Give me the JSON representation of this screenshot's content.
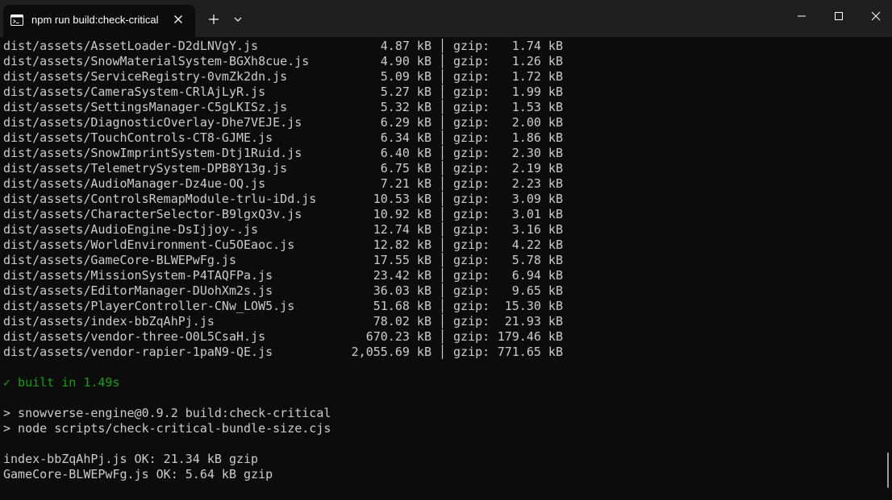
{
  "window": {
    "tab_title": "npm run build:check-critical",
    "tab_icon": "terminal-icon",
    "new_tab_icon": "plus-icon",
    "dropdown_icon": "chevron-down-icon",
    "controls": [
      "minimize-icon",
      "maximize-icon",
      "close-icon"
    ]
  },
  "colors": {
    "background": "#0c0c0c",
    "titlebar": "#1f1f1f",
    "text": "#cccccc",
    "success": "#13a10e"
  },
  "build_output": {
    "rows": [
      {
        "file": "dist/assets/AssetLoader-D2dLNVgY.js",
        "size": "4.87 kB",
        "sep": "│",
        "gzip_label": "gzip:",
        "gzip": "1.74 kB"
      },
      {
        "file": "dist/assets/SnowMaterialSystem-BGXh8cue.js",
        "size": "4.90 kB",
        "sep": "│",
        "gzip_label": "gzip:",
        "gzip": "1.26 kB"
      },
      {
        "file": "dist/assets/ServiceRegistry-0vmZk2dn.js",
        "size": "5.09 kB",
        "sep": "│",
        "gzip_label": "gzip:",
        "gzip": "1.72 kB"
      },
      {
        "file": "dist/assets/CameraSystem-CRlAjLyR.js",
        "size": "5.27 kB",
        "sep": "│",
        "gzip_label": "gzip:",
        "gzip": "1.99 kB"
      },
      {
        "file": "dist/assets/SettingsManager-C5gLKISz.js",
        "size": "5.32 kB",
        "sep": "│",
        "gzip_label": "gzip:",
        "gzip": "1.53 kB"
      },
      {
        "file": "dist/assets/DiagnosticOverlay-Dhe7VEJE.js",
        "size": "6.29 kB",
        "sep": "│",
        "gzip_label": "gzip:",
        "gzip": "2.00 kB"
      },
      {
        "file": "dist/assets/TouchControls-CT8-GJME.js",
        "size": "6.34 kB",
        "sep": "│",
        "gzip_label": "gzip:",
        "gzip": "1.86 kB"
      },
      {
        "file": "dist/assets/SnowImprintSystem-Dtj1Ruid.js",
        "size": "6.40 kB",
        "sep": "│",
        "gzip_label": "gzip:",
        "gzip": "2.30 kB"
      },
      {
        "file": "dist/assets/TelemetrySystem-DPB8Y13g.js",
        "size": "6.75 kB",
        "sep": "│",
        "gzip_label": "gzip:",
        "gzip": "2.19 kB"
      },
      {
        "file": "dist/assets/AudioManager-Dz4ue-OQ.js",
        "size": "7.21 kB",
        "sep": "│",
        "gzip_label": "gzip:",
        "gzip": "2.23 kB"
      },
      {
        "file": "dist/assets/ControlsRemapModule-trlu-iDd.js",
        "size": "10.53 kB",
        "sep": "│",
        "gzip_label": "gzip:",
        "gzip": "3.09 kB"
      },
      {
        "file": "dist/assets/CharacterSelector-B9lgxQ3v.js",
        "size": "10.92 kB",
        "sep": "│",
        "gzip_label": "gzip:",
        "gzip": "3.01 kB"
      },
      {
        "file": "dist/assets/AudioEngine-DsIjjoy-.js",
        "size": "12.74 kB",
        "sep": "│",
        "gzip_label": "gzip:",
        "gzip": "3.16 kB"
      },
      {
        "file": "dist/assets/WorldEnvironment-Cu5OEaoc.js",
        "size": "12.82 kB",
        "sep": "│",
        "gzip_label": "gzip:",
        "gzip": "4.22 kB"
      },
      {
        "file": "dist/assets/GameCore-BLWEPwFg.js",
        "size": "17.55 kB",
        "sep": "│",
        "gzip_label": "gzip:",
        "gzip": "5.78 kB"
      },
      {
        "file": "dist/assets/MissionSystem-P4TAQFPa.js",
        "size": "23.42 kB",
        "sep": "│",
        "gzip_label": "gzip:",
        "gzip": "6.94 kB"
      },
      {
        "file": "dist/assets/EditorManager-DUohXm2s.js",
        "size": "36.03 kB",
        "sep": "│",
        "gzip_label": "gzip:",
        "gzip": "9.65 kB"
      },
      {
        "file": "dist/assets/PlayerController-CNw_LOW5.js",
        "size": "51.68 kB",
        "sep": "│",
        "gzip_label": "gzip:",
        "gzip": "15.30 kB"
      },
      {
        "file": "dist/assets/index-bbZqAhPj.js",
        "size": "78.02 kB",
        "sep": "│",
        "gzip_label": "gzip:",
        "gzip": "21.93 kB"
      },
      {
        "file": "dist/assets/vendor-three-O0L5CsaH.js",
        "size": "670.23 kB",
        "sep": "│",
        "gzip_label": "gzip:",
        "gzip": "179.46 kB"
      },
      {
        "file": "dist/assets/vendor-rapier-1paN9-QE.js",
        "size": "2,055.69 kB",
        "sep": "│",
        "gzip_label": "gzip:",
        "gzip": "771.65 kB"
      }
    ],
    "built_line": "✓ built in 1.49s"
  },
  "script_lines": [
    "> snowverse-engine@0.9.2 build:check-critical",
    "> node scripts/check-critical-bundle-size.cjs"
  ],
  "check_lines": [
    "index-bbZqAhPj.js OK: 21.34 kB gzip",
    "GameCore-BLWEPwFg.js OK: 5.64 kB gzip"
  ]
}
